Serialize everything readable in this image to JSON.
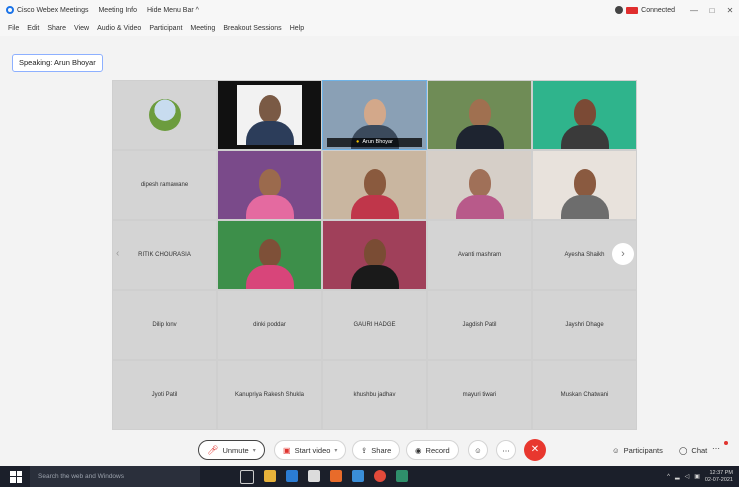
{
  "window": {
    "app_title": "Cisco Webex Meetings",
    "meeting_info": "Meeting Info",
    "hide_menu": "Hide Menu Bar ^",
    "status": "Connected",
    "controls": {
      "minimize": "—",
      "maximize": "□",
      "close": "✕"
    }
  },
  "menu": [
    "File",
    "Edit",
    "Share",
    "View",
    "Audio & Video",
    "Participant",
    "Meeting",
    "Breakout Sessions",
    "Help"
  ],
  "speaking": "Speaking: Arun Bhoyar",
  "tiles": [
    {
      "type": "avatar",
      "name": ""
    },
    {
      "type": "video",
      "name": "",
      "colors": [
        "#f2f2f2",
        "#7a5a45",
        "#2c3d5a"
      ]
    },
    {
      "type": "video",
      "name": "Arun Bhoyar",
      "selected": true,
      "colors": [
        "#8aa0b5",
        "#d3a88a",
        "#3b4a5c"
      ]
    },
    {
      "type": "video",
      "name": "",
      "colors": [
        "#6f8c56",
        "#a07050",
        "#1e2430"
      ]
    },
    {
      "type": "video",
      "name": "",
      "colors": [
        "#2fb48c",
        "#7b4a35",
        "#3a3a3a"
      ]
    },
    {
      "type": "name",
      "name": "dipesh ramawane"
    },
    {
      "type": "video",
      "name": "",
      "colors": [
        "#7a4a8a",
        "#9b6a4d",
        "#e46aa0"
      ]
    },
    {
      "type": "video",
      "name": "",
      "colors": [
        "#c9b6a0",
        "#8a5a3e",
        "#c0364a"
      ]
    },
    {
      "type": "video",
      "name": "",
      "colors": [
        "#d6cfc8",
        "#a07058",
        "#b85a8a"
      ]
    },
    {
      "type": "video",
      "name": "",
      "colors": [
        "#e8e2dc",
        "#8a5a40",
        "#6d6d6d"
      ]
    },
    {
      "type": "name",
      "name": "RITIK CHOURASIA"
    },
    {
      "type": "video",
      "name": "",
      "colors": [
        "#3d8f4a",
        "#7e5038",
        "#d8457a"
      ]
    },
    {
      "type": "video",
      "name": "",
      "colors": [
        "#a0405a",
        "#7a4c34",
        "#1a1a1a"
      ]
    },
    {
      "type": "name",
      "name": "Avanti mashram"
    },
    {
      "type": "name",
      "name": "Ayesha Shaikh"
    },
    {
      "type": "name",
      "name": "Dilip lonv"
    },
    {
      "type": "name",
      "name": "dinki poddar"
    },
    {
      "type": "name",
      "name": "GAURI HADGE"
    },
    {
      "type": "name",
      "name": "Jagdish Patil"
    },
    {
      "type": "name",
      "name": "Jayshri Dhage"
    },
    {
      "type": "name",
      "name": "Jyoti Patil"
    },
    {
      "type": "name",
      "name": "Kanupriya Rakesh Shukla"
    },
    {
      "type": "name",
      "name": "khushbu jadhav"
    },
    {
      "type": "name",
      "name": "mayuri tiwari"
    },
    {
      "type": "name",
      "name": "Muskan Chatwani"
    }
  ],
  "toolbar": {
    "unmute": "Unmute",
    "start_video": "Start video",
    "share": "Share",
    "record": "Record",
    "participants": "Participants",
    "chat": "Chat"
  },
  "taskbar": {
    "search_placeholder": "Search the web and Windows",
    "time": "12:37 PM",
    "date": "02-07-2021"
  },
  "colors": {
    "accent": "#1a73e8",
    "end_red": "#e8372e",
    "taskbar": "#1b1f2a"
  }
}
